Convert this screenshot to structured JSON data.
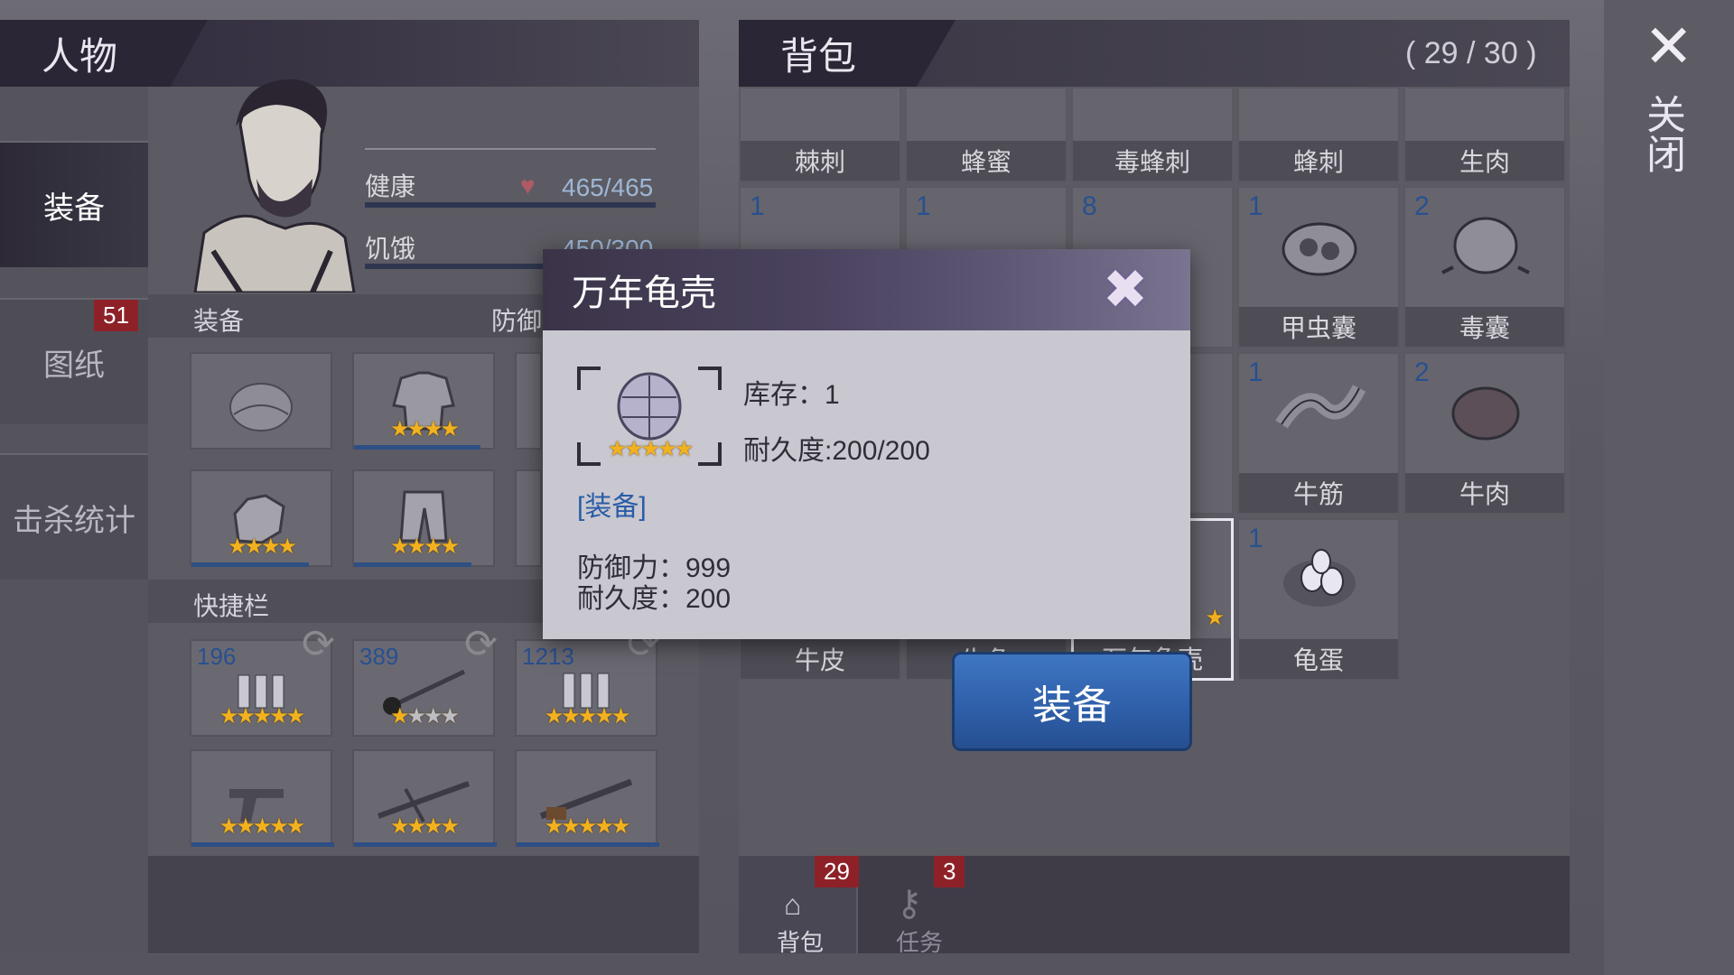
{
  "character": {
    "title": "人物",
    "nav": [
      {
        "label": "装备"
      },
      {
        "label": "图纸",
        "badge": "51"
      },
      {
        "label": "击杀统计"
      }
    ],
    "stats": {
      "health_label": "健康",
      "health_value": "465/465",
      "hunger_label": "饥饿",
      "hunger_value": "450/300"
    },
    "equip_label": "装备",
    "defense_label": "防御",
    "quickbar_label": "快捷栏",
    "quickbar_counts": [
      "196",
      "389",
      "1213"
    ]
  },
  "bag": {
    "title": "背包",
    "capacity": "( 29 / 30 )",
    "rows": [
      [
        {
          "name": "棘刺"
        },
        {
          "name": "蜂蜜"
        },
        {
          "name": "毒蜂刺"
        },
        {
          "name": "蜂刺"
        },
        {
          "name": "生肉"
        }
      ],
      [
        {
          "qty": "1",
          "name": ""
        },
        {
          "qty": "1",
          "name": ""
        },
        {
          "qty": "8",
          "name": ""
        },
        {
          "qty": "1",
          "name": "甲虫囊"
        },
        {
          "qty": "2",
          "name": "毒囊"
        }
      ],
      [
        {
          "qty": "",
          "name": ""
        },
        {
          "qty": "",
          "name": ""
        },
        {
          "qty": "",
          "name": ""
        },
        {
          "qty": "1",
          "name": "牛筋"
        },
        {
          "qty": "2",
          "name": "牛肉"
        }
      ],
      [
        {
          "qty": "",
          "name": "牛皮"
        },
        {
          "qty": "",
          "name": "牛角"
        },
        {
          "qty": "",
          "name": "万年龟壳"
        },
        {
          "qty": "1",
          "name": "龟蛋"
        }
      ]
    ],
    "tabs": [
      {
        "label": "背包",
        "badge": "29"
      },
      {
        "label": "任务",
        "badge": "3"
      }
    ]
  },
  "close_label": "关闭",
  "modal": {
    "title": "万年龟壳",
    "stock": "库存：1",
    "durability": "耐久度:200/200",
    "tag": "[装备]",
    "defense": "防御力：999",
    "durability2": "耐久度：200"
  },
  "equip_button": "装备",
  "colors": {
    "accent_blue": "#2e5ea8",
    "star": "#f2b21f",
    "badge_red": "#8e2128"
  }
}
